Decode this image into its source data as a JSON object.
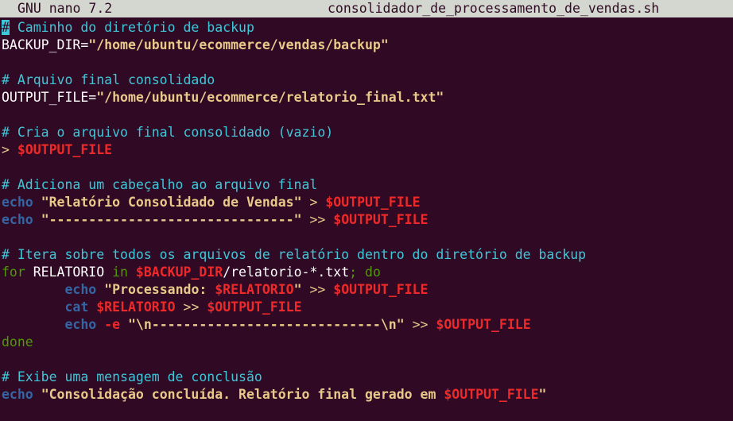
{
  "titlebar": {
    "app": "GNU nano 7.2",
    "filename": "consolidador_de_processamento_de_vendas.sh"
  },
  "lines": [
    [
      {
        "c": "cursor",
        "t": "#"
      },
      {
        "c": "cm",
        "t": " Caminho do diretório de backup"
      }
    ],
    [
      {
        "c": "plain",
        "t": "BACKUP_DIR="
      },
      {
        "c": "str",
        "t": "\"/home/ubuntu/ecommerce/vendas/backup\""
      }
    ],
    [],
    [
      {
        "c": "cm",
        "t": "# Arquivo final consolidado"
      }
    ],
    [
      {
        "c": "plain",
        "t": "OUTPUT_FILE="
      },
      {
        "c": "str",
        "t": "\"/home/ubuntu/ecommerce/relatorio_final.txt\""
      }
    ],
    [],
    [
      {
        "c": "cm",
        "t": "# Cria o arquivo final consolidado (vazio)"
      }
    ],
    [
      {
        "c": "op",
        "t": "> "
      },
      {
        "c": "var",
        "t": "$OUTPUT_FILE"
      }
    ],
    [],
    [
      {
        "c": "cm",
        "t": "# Adiciona um cabeçalho ao arquivo final"
      }
    ],
    [
      {
        "c": "cmd",
        "t": "echo"
      },
      {
        "c": "plain",
        "t": " "
      },
      {
        "c": "str",
        "t": "\"Relatório Consolidado de Vendas\""
      },
      {
        "c": "op",
        "t": " > "
      },
      {
        "c": "var",
        "t": "$OUTPUT_FILE"
      }
    ],
    [
      {
        "c": "cmd",
        "t": "echo"
      },
      {
        "c": "plain",
        "t": " "
      },
      {
        "c": "str",
        "t": "\"-------------------------------\""
      },
      {
        "c": "op",
        "t": " >> "
      },
      {
        "c": "var",
        "t": "$OUTPUT_FILE"
      }
    ],
    [],
    [
      {
        "c": "cm",
        "t": "# Itera sobre todos os arquivos de relatório dentro do diretório de backup"
      }
    ],
    [
      {
        "c": "kw2",
        "t": "for"
      },
      {
        "c": "plain",
        "t": " RELATORIO "
      },
      {
        "c": "kw2",
        "t": "in"
      },
      {
        "c": "plain",
        "t": " "
      },
      {
        "c": "var",
        "t": "$BACKUP_DIR"
      },
      {
        "c": "plain",
        "t": "/relatorio-*.txt"
      },
      {
        "c": "kw2",
        "t": "; do"
      }
    ],
    [
      {
        "c": "plain",
        "t": "        "
      },
      {
        "c": "cmd",
        "t": "echo"
      },
      {
        "c": "plain",
        "t": " "
      },
      {
        "c": "str",
        "t": "\"Processando: "
      },
      {
        "c": "var",
        "t": "$RELATORIO"
      },
      {
        "c": "str",
        "t": "\""
      },
      {
        "c": "op",
        "t": " >> "
      },
      {
        "c": "var",
        "t": "$OUTPUT_FILE"
      }
    ],
    [
      {
        "c": "plain",
        "t": "        "
      },
      {
        "c": "cmd",
        "t": "cat"
      },
      {
        "c": "plain",
        "t": " "
      },
      {
        "c": "var",
        "t": "$RELATORIO"
      },
      {
        "c": "op",
        "t": " >> "
      },
      {
        "c": "var",
        "t": "$OUTPUT_FILE"
      }
    ],
    [
      {
        "c": "plain",
        "t": "        "
      },
      {
        "c": "cmd",
        "t": "echo"
      },
      {
        "c": "plain",
        "t": " "
      },
      {
        "c": "flag",
        "t": "-e"
      },
      {
        "c": "plain",
        "t": " "
      },
      {
        "c": "str",
        "t": "\"\\n-----------------------------\\n\""
      },
      {
        "c": "op",
        "t": " >> "
      },
      {
        "c": "var",
        "t": "$OUTPUT_FILE"
      }
    ],
    [
      {
        "c": "kw2",
        "t": "done"
      }
    ],
    [],
    [
      {
        "c": "cm",
        "t": "# Exibe uma mensagem de conclusão"
      }
    ],
    [
      {
        "c": "cmd",
        "t": "echo"
      },
      {
        "c": "plain",
        "t": " "
      },
      {
        "c": "str",
        "t": "\"Consolidação concluída. Relatório final gerado em "
      },
      {
        "c": "var",
        "t": "$OUTPUT_FILE"
      },
      {
        "c": "str",
        "t": "\""
      }
    ]
  ],
  "colors": {
    "background": "#300a24",
    "titlebar": "#d3d7cf",
    "comment": "#3ec7d9",
    "string": "#e9c98a",
    "variable": "#ef2929",
    "keyword": "#4e9a06",
    "command": "#3465a4"
  }
}
